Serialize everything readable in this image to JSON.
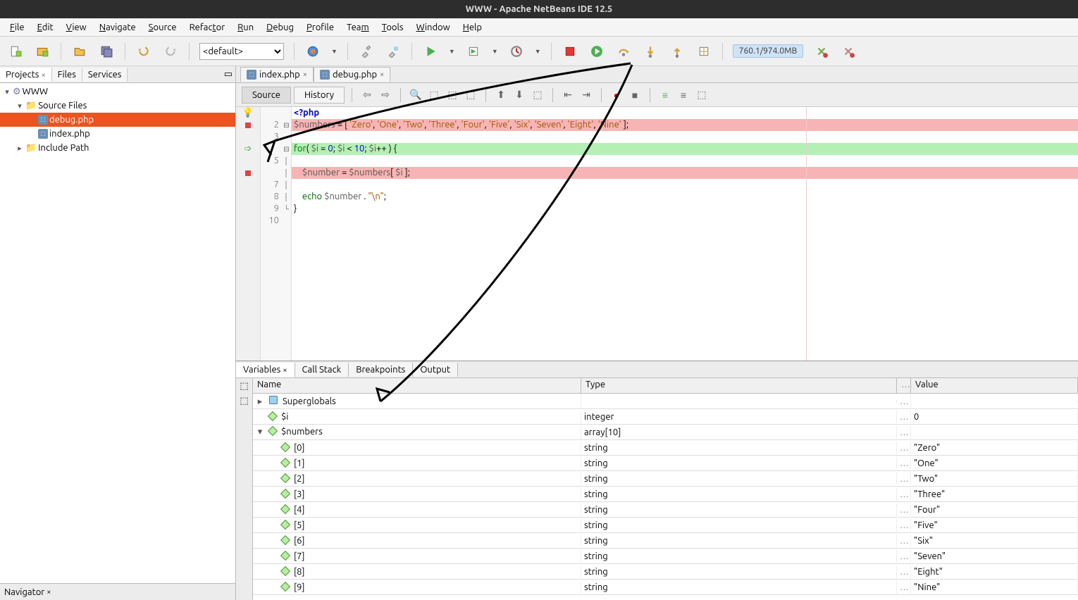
{
  "titlebar": "WWW - Apache NetBeans IDE 12.5",
  "menus": [
    "File",
    "Edit",
    "View",
    "Navigate",
    "Source",
    "Refactor",
    "Run",
    "Debug",
    "Profile",
    "Team",
    "Tools",
    "Window",
    "Help"
  ],
  "toolbar": {
    "config": "<default>",
    "memory": "760.1/974.0MB"
  },
  "leftTabs": {
    "t1": "Projects",
    "t2": "Files",
    "t3": "Services"
  },
  "tree": {
    "root": "WWW",
    "folder1": "Source Files",
    "file1": "debug.php",
    "file2": "index.php",
    "folder2": "Include Path"
  },
  "navigator": "Navigator",
  "editorTabs": {
    "t1": "index.php",
    "t2": "debug.php"
  },
  "editorToolbar": {
    "source": "Source",
    "history": "History"
  },
  "code": {
    "l1": "<?php",
    "l2": "$numbers = [ 'Zero', 'One', 'Two', 'Three', 'Four', 'Five', 'Six', 'Seven', 'Eight', 'Nine' ];",
    "l3": "",
    "l4": "for( $i = 0; $i < 10; $i++ ) {",
    "l5": "",
    "l6": "    $number = $numbers[ $i ];",
    "l7": "",
    "l8": "    echo $number . \"\\n\";",
    "l9": "}",
    "lineNumbers": [
      "",
      "2",
      "3",
      "",
      "5",
      "",
      "7",
      "8",
      "9",
      "10"
    ]
  },
  "bottomTabs": {
    "t1": "Variables",
    "t2": "Call Stack",
    "t3": "Breakpoints",
    "t4": "Output"
  },
  "varHeader": {
    "name": "Name",
    "type": "Type",
    "value": "Value"
  },
  "vars": [
    {
      "indent": 0,
      "exp": "▸",
      "name": "Superglobals",
      "type": "",
      "value": "",
      "icon": "blue"
    },
    {
      "indent": 0,
      "exp": "",
      "name": "$i",
      "type": "integer",
      "value": "0",
      "icon": "green"
    },
    {
      "indent": 0,
      "exp": "▾",
      "name": "$numbers",
      "type": "array[10]",
      "value": "",
      "icon": "green"
    },
    {
      "indent": 1,
      "exp": "",
      "name": "[0]",
      "type": "string",
      "value": "\"Zero\"",
      "icon": "green"
    },
    {
      "indent": 1,
      "exp": "",
      "name": "[1]",
      "type": "string",
      "value": "\"One\"",
      "icon": "green"
    },
    {
      "indent": 1,
      "exp": "",
      "name": "[2]",
      "type": "string",
      "value": "\"Two\"",
      "icon": "green"
    },
    {
      "indent": 1,
      "exp": "",
      "name": "[3]",
      "type": "string",
      "value": "\"Three\"",
      "icon": "green"
    },
    {
      "indent": 1,
      "exp": "",
      "name": "[4]",
      "type": "string",
      "value": "\"Four\"",
      "icon": "green"
    },
    {
      "indent": 1,
      "exp": "",
      "name": "[5]",
      "type": "string",
      "value": "\"Five\"",
      "icon": "green"
    },
    {
      "indent": 1,
      "exp": "",
      "name": "[6]",
      "type": "string",
      "value": "\"Six\"",
      "icon": "green"
    },
    {
      "indent": 1,
      "exp": "",
      "name": "[7]",
      "type": "string",
      "value": "\"Seven\"",
      "icon": "green"
    },
    {
      "indent": 1,
      "exp": "",
      "name": "[8]",
      "type": "string",
      "value": "\"Eight\"",
      "icon": "green"
    },
    {
      "indent": 1,
      "exp": "",
      "name": "[9]",
      "type": "string",
      "value": "\"Nine\"",
      "icon": "green"
    }
  ]
}
